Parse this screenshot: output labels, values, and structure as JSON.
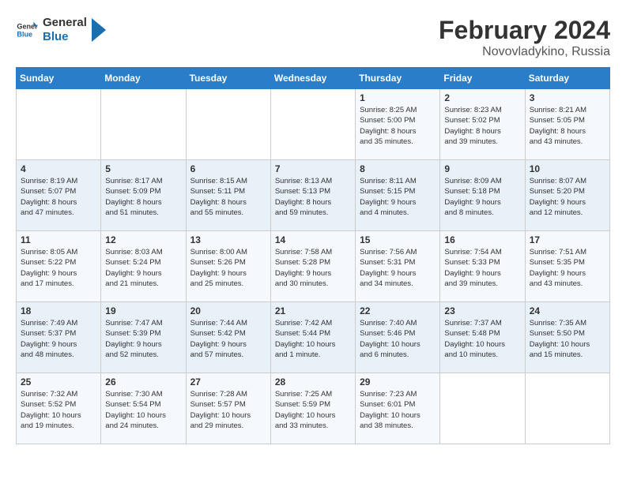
{
  "header": {
    "logo_general": "General",
    "logo_blue": "Blue",
    "month_year": "February 2024",
    "location": "Novovladykino, Russia"
  },
  "days_of_week": [
    "Sunday",
    "Monday",
    "Tuesday",
    "Wednesday",
    "Thursday",
    "Friday",
    "Saturday"
  ],
  "weeks": [
    [
      {
        "num": "",
        "info": ""
      },
      {
        "num": "",
        "info": ""
      },
      {
        "num": "",
        "info": ""
      },
      {
        "num": "",
        "info": ""
      },
      {
        "num": "1",
        "info": "Sunrise: 8:25 AM\nSunset: 5:00 PM\nDaylight: 8 hours\nand 35 minutes."
      },
      {
        "num": "2",
        "info": "Sunrise: 8:23 AM\nSunset: 5:02 PM\nDaylight: 8 hours\nand 39 minutes."
      },
      {
        "num": "3",
        "info": "Sunrise: 8:21 AM\nSunset: 5:05 PM\nDaylight: 8 hours\nand 43 minutes."
      }
    ],
    [
      {
        "num": "4",
        "info": "Sunrise: 8:19 AM\nSunset: 5:07 PM\nDaylight: 8 hours\nand 47 minutes."
      },
      {
        "num": "5",
        "info": "Sunrise: 8:17 AM\nSunset: 5:09 PM\nDaylight: 8 hours\nand 51 minutes."
      },
      {
        "num": "6",
        "info": "Sunrise: 8:15 AM\nSunset: 5:11 PM\nDaylight: 8 hours\nand 55 minutes."
      },
      {
        "num": "7",
        "info": "Sunrise: 8:13 AM\nSunset: 5:13 PM\nDaylight: 8 hours\nand 59 minutes."
      },
      {
        "num": "8",
        "info": "Sunrise: 8:11 AM\nSunset: 5:15 PM\nDaylight: 9 hours\nand 4 minutes."
      },
      {
        "num": "9",
        "info": "Sunrise: 8:09 AM\nSunset: 5:18 PM\nDaylight: 9 hours\nand 8 minutes."
      },
      {
        "num": "10",
        "info": "Sunrise: 8:07 AM\nSunset: 5:20 PM\nDaylight: 9 hours\nand 12 minutes."
      }
    ],
    [
      {
        "num": "11",
        "info": "Sunrise: 8:05 AM\nSunset: 5:22 PM\nDaylight: 9 hours\nand 17 minutes."
      },
      {
        "num": "12",
        "info": "Sunrise: 8:03 AM\nSunset: 5:24 PM\nDaylight: 9 hours\nand 21 minutes."
      },
      {
        "num": "13",
        "info": "Sunrise: 8:00 AM\nSunset: 5:26 PM\nDaylight: 9 hours\nand 25 minutes."
      },
      {
        "num": "14",
        "info": "Sunrise: 7:58 AM\nSunset: 5:28 PM\nDaylight: 9 hours\nand 30 minutes."
      },
      {
        "num": "15",
        "info": "Sunrise: 7:56 AM\nSunset: 5:31 PM\nDaylight: 9 hours\nand 34 minutes."
      },
      {
        "num": "16",
        "info": "Sunrise: 7:54 AM\nSunset: 5:33 PM\nDaylight: 9 hours\nand 39 minutes."
      },
      {
        "num": "17",
        "info": "Sunrise: 7:51 AM\nSunset: 5:35 PM\nDaylight: 9 hours\nand 43 minutes."
      }
    ],
    [
      {
        "num": "18",
        "info": "Sunrise: 7:49 AM\nSunset: 5:37 PM\nDaylight: 9 hours\nand 48 minutes."
      },
      {
        "num": "19",
        "info": "Sunrise: 7:47 AM\nSunset: 5:39 PM\nDaylight: 9 hours\nand 52 minutes."
      },
      {
        "num": "20",
        "info": "Sunrise: 7:44 AM\nSunset: 5:42 PM\nDaylight: 9 hours\nand 57 minutes."
      },
      {
        "num": "21",
        "info": "Sunrise: 7:42 AM\nSunset: 5:44 PM\nDaylight: 10 hours\nand 1 minute."
      },
      {
        "num": "22",
        "info": "Sunrise: 7:40 AM\nSunset: 5:46 PM\nDaylight: 10 hours\nand 6 minutes."
      },
      {
        "num": "23",
        "info": "Sunrise: 7:37 AM\nSunset: 5:48 PM\nDaylight: 10 hours\nand 10 minutes."
      },
      {
        "num": "24",
        "info": "Sunrise: 7:35 AM\nSunset: 5:50 PM\nDaylight: 10 hours\nand 15 minutes."
      }
    ],
    [
      {
        "num": "25",
        "info": "Sunrise: 7:32 AM\nSunset: 5:52 PM\nDaylight: 10 hours\nand 19 minutes."
      },
      {
        "num": "26",
        "info": "Sunrise: 7:30 AM\nSunset: 5:54 PM\nDaylight: 10 hours\nand 24 minutes."
      },
      {
        "num": "27",
        "info": "Sunrise: 7:28 AM\nSunset: 5:57 PM\nDaylight: 10 hours\nand 29 minutes."
      },
      {
        "num": "28",
        "info": "Sunrise: 7:25 AM\nSunset: 5:59 PM\nDaylight: 10 hours\nand 33 minutes."
      },
      {
        "num": "29",
        "info": "Sunrise: 7:23 AM\nSunset: 6:01 PM\nDaylight: 10 hours\nand 38 minutes."
      },
      {
        "num": "",
        "info": ""
      },
      {
        "num": "",
        "info": ""
      }
    ]
  ]
}
